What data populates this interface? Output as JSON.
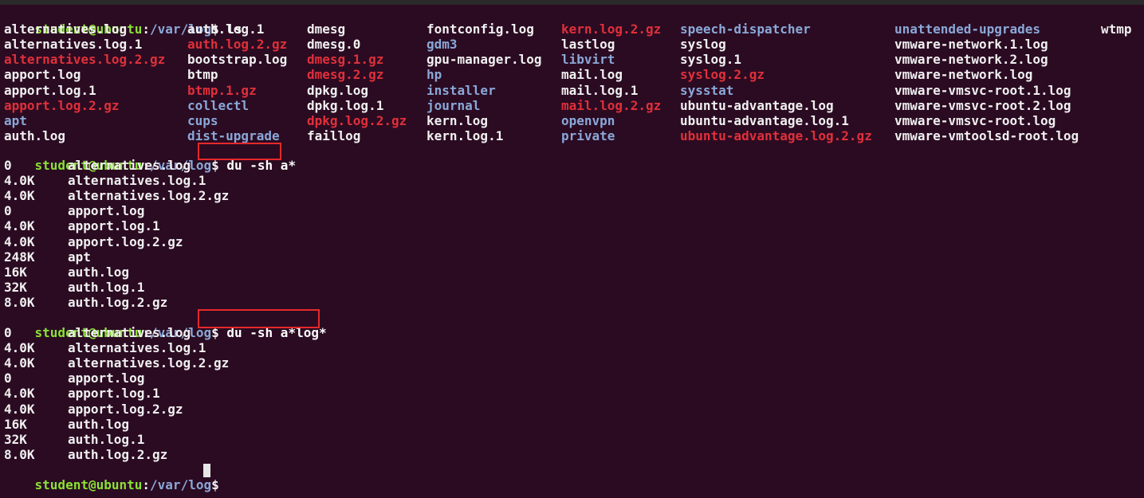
{
  "prompt": {
    "user": "student@ubuntu",
    "sep": ":",
    "path": "/var/log",
    "dollar": "$"
  },
  "commands": {
    "ls": "ls",
    "du1": "du -sh a*",
    "du2": "du -sh a*log*"
  },
  "ls_columns": [
    [
      {
        "name": "alternatives.log",
        "type": "normal"
      },
      {
        "name": "alternatives.log.1",
        "type": "normal"
      },
      {
        "name": "alternatives.log.2.gz",
        "type": "archive"
      },
      {
        "name": "apport.log",
        "type": "normal"
      },
      {
        "name": "apport.log.1",
        "type": "normal"
      },
      {
        "name": "apport.log.2.gz",
        "type": "archive"
      },
      {
        "name": "apt",
        "type": "dir"
      },
      {
        "name": "auth.log",
        "type": "normal"
      }
    ],
    [
      {
        "name": "auth.log.1",
        "type": "normal"
      },
      {
        "name": "auth.log.2.gz",
        "type": "archive"
      },
      {
        "name": "bootstrap.log",
        "type": "normal"
      },
      {
        "name": "btmp",
        "type": "normal"
      },
      {
        "name": "btmp.1.gz",
        "type": "archive"
      },
      {
        "name": "collectl",
        "type": "dir"
      },
      {
        "name": "cups",
        "type": "dir"
      },
      {
        "name": "dist-upgrade",
        "type": "dir"
      }
    ],
    [
      {
        "name": "dmesg",
        "type": "normal"
      },
      {
        "name": "dmesg.0",
        "type": "normal"
      },
      {
        "name": "dmesg.1.gz",
        "type": "archive"
      },
      {
        "name": "dmesg.2.gz",
        "type": "archive"
      },
      {
        "name": "dpkg.log",
        "type": "normal"
      },
      {
        "name": "dpkg.log.1",
        "type": "normal"
      },
      {
        "name": "dpkg.log.2.gz",
        "type": "archive"
      },
      {
        "name": "faillog",
        "type": "normal"
      }
    ],
    [
      {
        "name": "fontconfig.log",
        "type": "normal"
      },
      {
        "name": "gdm3",
        "type": "dir"
      },
      {
        "name": "gpu-manager.log",
        "type": "normal"
      },
      {
        "name": "hp",
        "type": "dir"
      },
      {
        "name": "installer",
        "type": "dir"
      },
      {
        "name": "journal",
        "type": "dir"
      },
      {
        "name": "kern.log",
        "type": "normal"
      },
      {
        "name": "kern.log.1",
        "type": "normal"
      }
    ],
    [
      {
        "name": "kern.log.2.gz",
        "type": "archive"
      },
      {
        "name": "lastlog",
        "type": "normal"
      },
      {
        "name": "libvirt",
        "type": "dir"
      },
      {
        "name": "mail.log",
        "type": "normal"
      },
      {
        "name": "mail.log.1",
        "type": "normal"
      },
      {
        "name": "mail.log.2.gz",
        "type": "archive"
      },
      {
        "name": "openvpn",
        "type": "dir"
      },
      {
        "name": "private",
        "type": "dir"
      }
    ],
    [
      {
        "name": "speech-dispatcher",
        "type": "dir"
      },
      {
        "name": "syslog",
        "type": "normal"
      },
      {
        "name": "syslog.1",
        "type": "normal"
      },
      {
        "name": "syslog.2.gz",
        "type": "archive"
      },
      {
        "name": "sysstat",
        "type": "dir"
      },
      {
        "name": "ubuntu-advantage.log",
        "type": "normal"
      },
      {
        "name": "ubuntu-advantage.log.1",
        "type": "normal"
      },
      {
        "name": "ubuntu-advantage.log.2.gz",
        "type": "archive"
      }
    ],
    [
      {
        "name": "unattended-upgrades",
        "type": "dir"
      },
      {
        "name": "vmware-network.1.log",
        "type": "normal"
      },
      {
        "name": "vmware-network.2.log",
        "type": "normal"
      },
      {
        "name": "vmware-network.log",
        "type": "normal"
      },
      {
        "name": "vmware-vmsvc-root.1.log",
        "type": "normal"
      },
      {
        "name": "vmware-vmsvc-root.2.log",
        "type": "normal"
      },
      {
        "name": "vmware-vmsvc-root.log",
        "type": "normal"
      },
      {
        "name": "vmware-vmtoolsd-root.log",
        "type": "normal"
      }
    ],
    [
      {
        "name": "wtmp",
        "type": "normal"
      }
    ]
  ],
  "du1_output": [
    {
      "size": "0",
      "name": "alternatives.log"
    },
    {
      "size": "4.0K",
      "name": "alternatives.log.1"
    },
    {
      "size": "4.0K",
      "name": "alternatives.log.2.gz"
    },
    {
      "size": "0",
      "name": "apport.log"
    },
    {
      "size": "4.0K",
      "name": "apport.log.1"
    },
    {
      "size": "4.0K",
      "name": "apport.log.2.gz"
    },
    {
      "size": "248K",
      "name": "apt"
    },
    {
      "size": "16K",
      "name": "auth.log"
    },
    {
      "size": "32K",
      "name": "auth.log.1"
    },
    {
      "size": "8.0K",
      "name": "auth.log.2.gz"
    }
  ],
  "du2_output": [
    {
      "size": "0",
      "name": "alternatives.log"
    },
    {
      "size": "4.0K",
      "name": "alternatives.log.1"
    },
    {
      "size": "4.0K",
      "name": "alternatives.log.2.gz"
    },
    {
      "size": "0",
      "name": "apport.log"
    },
    {
      "size": "4.0K",
      "name": "apport.log.1"
    },
    {
      "size": "4.0K",
      "name": "apport.log.2.gz"
    },
    {
      "size": "16K",
      "name": "auth.log"
    },
    {
      "size": "32K",
      "name": "auth.log.1"
    },
    {
      "size": "8.0K",
      "name": "auth.log.2.gz"
    }
  ],
  "colors": {
    "background": "#2b0b22",
    "prompt_user": "#8ae234",
    "prompt_path": "#8aa8d8",
    "archive_file": "#e0303a",
    "directory": "#8aa8d8",
    "normal_file": "#f0f0f0",
    "highlight_box": "#e5292a"
  }
}
